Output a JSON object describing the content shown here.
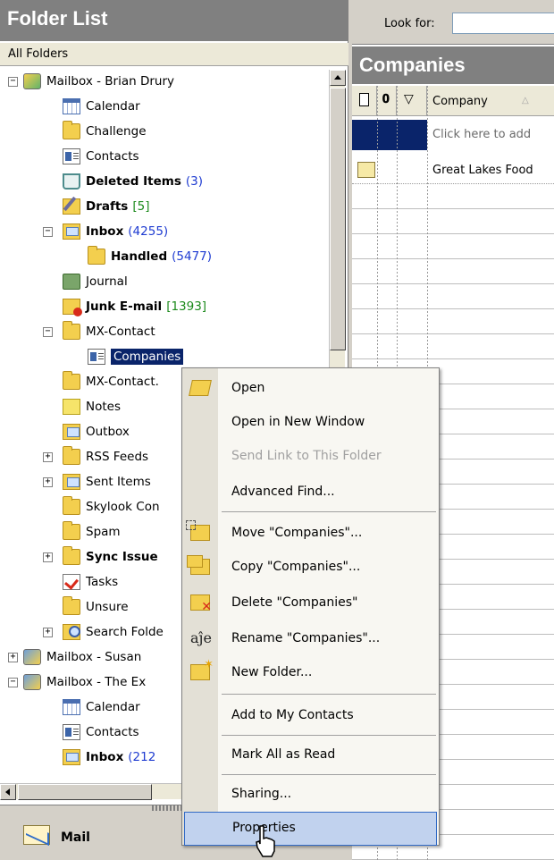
{
  "folder_list": {
    "title": "Folder List",
    "all_folders_label": "All Folders",
    "items": [
      {
        "label": "Mailbox - Brian Drury",
        "count": ""
      },
      {
        "label": "Calendar",
        "count": ""
      },
      {
        "label": "Challenge",
        "count": ""
      },
      {
        "label": "Contacts",
        "count": ""
      },
      {
        "label": "Deleted Items",
        "count": "(3)"
      },
      {
        "label": "Drafts",
        "count": "[5]"
      },
      {
        "label": "Inbox",
        "count": "(4255)"
      },
      {
        "label": "Handled",
        "count": "(5477)"
      },
      {
        "label": "Journal",
        "count": ""
      },
      {
        "label": "Junk E-mail",
        "count": "[1393]"
      },
      {
        "label": "MX-Contact",
        "count": ""
      },
      {
        "label": "Companies",
        "count": ""
      },
      {
        "label": "MX-Contact.",
        "count": ""
      },
      {
        "label": "Notes",
        "count": ""
      },
      {
        "label": "Outbox",
        "count": ""
      },
      {
        "label": "RSS Feeds",
        "count": ""
      },
      {
        "label": "Sent Items",
        "count": ""
      },
      {
        "label": "Skylook Con",
        "count": ""
      },
      {
        "label": "Spam",
        "count": ""
      },
      {
        "label": "Sync Issue",
        "count": ""
      },
      {
        "label": "Tasks",
        "count": ""
      },
      {
        "label": "Unsure",
        "count": ""
      },
      {
        "label": "Search Folde",
        "count": ""
      },
      {
        "label": "Mailbox - Susan",
        "count": ""
      },
      {
        "label": "Mailbox - The Ex",
        "count": ""
      },
      {
        "label": "Calendar",
        "count": ""
      },
      {
        "label": "Contacts",
        "count": ""
      },
      {
        "label": "Inbox",
        "count": "(212"
      }
    ],
    "expander_minus": "−",
    "expander_plus": "+"
  },
  "nav": {
    "mail_label": "Mail"
  },
  "right_pane": {
    "look_for_label": "Look for:",
    "look_for_value": "",
    "title": "Companies",
    "columns": {
      "company": "Company",
      "sort_indicator": "△"
    },
    "new_row_placeholder": "Click here to add",
    "rows": [
      {
        "company": "Great Lakes Food"
      }
    ]
  },
  "context_menu": {
    "items": [
      {
        "label": "Open"
      },
      {
        "label": "Open in New Window"
      },
      {
        "label": "Send Link to This Folder"
      },
      {
        "label": "Advanced Find..."
      },
      {
        "label": "Move \"Companies\"..."
      },
      {
        "label": "Copy \"Companies\"..."
      },
      {
        "label": "Delete \"Companies\""
      },
      {
        "label": "Rename \"Companies\"..."
      },
      {
        "label": "New Folder..."
      },
      {
        "label": "Add to My Contacts"
      },
      {
        "label": "Mark All as Read"
      },
      {
        "label": "Sharing..."
      },
      {
        "label": "Properties"
      }
    ],
    "rename_icon_text": "aĵe"
  },
  "colors": {
    "header_gray": "#808080",
    "selection_navy": "#0a246a",
    "count_blue": "#1f3cd1",
    "count_green": "#1c8a1c",
    "menu_highlight": "#c1d2ee"
  }
}
